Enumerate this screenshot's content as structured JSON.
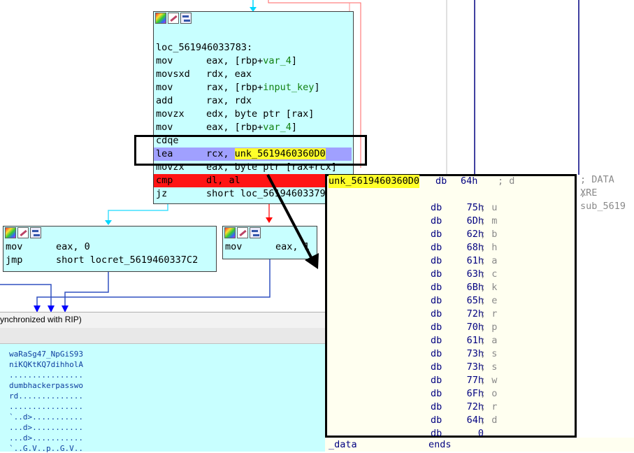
{
  "main_block": {
    "label": "loc_561946033783:",
    "lines": [
      {
        "op": "mov",
        "args": "eax, [rbp+",
        "var": "var_4",
        "end": "]"
      },
      {
        "op": "movsxd",
        "args": "rdx, eax",
        "var": "",
        "end": ""
      },
      {
        "op": "mov",
        "args": "rax, [rbp+",
        "var": "input_key",
        "end": "]"
      },
      {
        "op": "add",
        "args": "rax, rdx",
        "var": "",
        "end": ""
      },
      {
        "op": "movzx",
        "args": "edx, byte ptr [rax]",
        "var": "",
        "end": ""
      },
      {
        "op": "mov",
        "args": "eax, [rbp+",
        "var": "var_4",
        "end": "]"
      },
      {
        "op": "cdqe",
        "args": "",
        "var": "",
        "end": ""
      }
    ],
    "lea": {
      "op": "lea",
      "args": "rcx, ",
      "target": "unk_5619460360D0"
    },
    "movzx2": {
      "op": "movzx",
      "args": "eax, byte ptr [rax+rcx]"
    },
    "cmp": {
      "op": "cmp",
      "args": "dl, al"
    },
    "jz": {
      "op": "jz",
      "args": "short loc_56194603379"
    }
  },
  "left_block": {
    "lines": [
      {
        "op": "mov",
        "args": "eax, 0"
      },
      {
        "op": "jmp",
        "args": "short locret_5619460337C2"
      }
    ]
  },
  "right_block": {
    "line": {
      "op": "mov",
      "args": "eax, 1"
    }
  },
  "sync_label": "ynchronized with RIP)",
  "xref": {
    "line1": "; DATA XRE",
    "line2": "; sub_5619"
  },
  "hex_dump": [
    "waRaSg47_NpGiS93",
    "niKQKtKQ7dihholA",
    "................",
    "dumbhackerpasswo",
    "rd..............",
    "................",
    "`..d>...........",
    "...d>...........",
    "...d>...........",
    "`..G.V..p..G.V.."
  ],
  "popup": {
    "label": "unk_5619460360D0",
    "first": {
      "dir": "db",
      "val": "64h",
      "ch": "; d"
    },
    "rows": [
      {
        "dir": "db",
        "val": "75h",
        "ch": "; u"
      },
      {
        "dir": "db",
        "val": "6Dh",
        "ch": "; m"
      },
      {
        "dir": "db",
        "val": "62h",
        "ch": "; b"
      },
      {
        "dir": "db",
        "val": "68h",
        "ch": "; h"
      },
      {
        "dir": "db",
        "val": "61h",
        "ch": "; a"
      },
      {
        "dir": "db",
        "val": "63h",
        "ch": "; c"
      },
      {
        "dir": "db",
        "val": "6Bh",
        "ch": "; k"
      },
      {
        "dir": "db",
        "val": "65h",
        "ch": "; e"
      },
      {
        "dir": "db",
        "val": "72h",
        "ch": "; r"
      },
      {
        "dir": "db",
        "val": "70h",
        "ch": "; p"
      },
      {
        "dir": "db",
        "val": "61h",
        "ch": "; a"
      },
      {
        "dir": "db",
        "val": "73h",
        "ch": "; s"
      },
      {
        "dir": "db",
        "val": "73h",
        "ch": "; s"
      },
      {
        "dir": "db",
        "val": "77h",
        "ch": "; w"
      },
      {
        "dir": "db",
        "val": "6Fh",
        "ch": "; o"
      },
      {
        "dir": "db",
        "val": "72h",
        "ch": "; r"
      },
      {
        "dir": "db",
        "val": "64h",
        "ch": "; d"
      },
      {
        "dir": "db",
        "val": "0",
        "ch": ""
      }
    ],
    "footer_seg": "_data",
    "footer_kw": "ends"
  }
}
